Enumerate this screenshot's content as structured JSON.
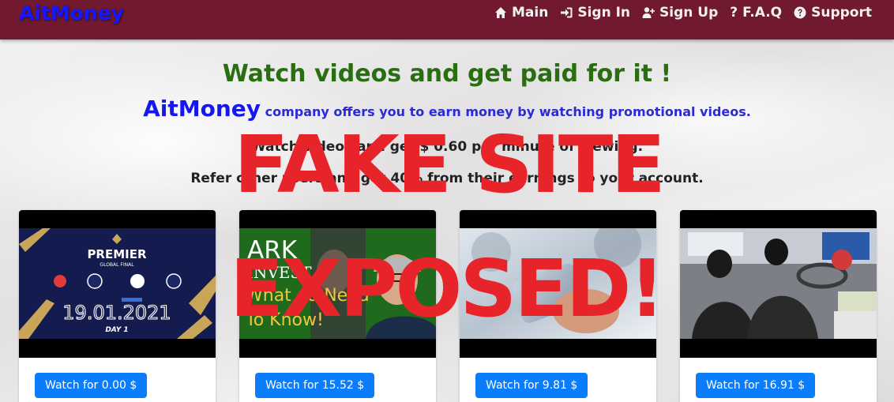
{
  "navbar": {
    "brand": "AitMoney",
    "items": [
      {
        "label": "Main",
        "icon": "home-icon"
      },
      {
        "label": "Sign In",
        "icon": "sign-in-icon"
      },
      {
        "label": "Sign Up",
        "icon": "user-plus-icon"
      },
      {
        "label": "F.A.Q",
        "icon": "question-icon"
      },
      {
        "label": "Support",
        "icon": "question-circle-icon"
      }
    ]
  },
  "hero": {
    "headline": "Watch videos and get paid for it !",
    "brand_word": "AitMoney",
    "offer_text": "company offers you to earn money",
    "offer_bold": "by watching promotional videos.",
    "rate_line": "Watch videos and get $ 0.60 per minute of viewing.",
    "referral_line": "Refer other users and get 40% from their earnings to your account."
  },
  "overlay": {
    "line1": "FAKE SITE",
    "line2": "EXPOSED!"
  },
  "cards": [
    {
      "thumb_title": "PREMIER",
      "thumb_subtitle": "GLOBAL FINAL",
      "thumb_date": "19.01.2021",
      "thumb_day": "DAY 1",
      "button": "Watch for 0.00 $"
    },
    {
      "thumb_title": "ARK",
      "thumb_subtitle": "INVEST",
      "thumb_caption1": "What ou Need",
      "thumb_caption2": "To Know!",
      "button": "Watch for 15.52 $"
    },
    {
      "button": "Watch for 9.81 $"
    },
    {
      "button": "Watch for 16.91 $"
    }
  ],
  "colors": {
    "navbar": "#71192e",
    "brand": "#1616ff",
    "headline": "#2a6e12",
    "button": "#0b7dfa",
    "overlay": "#e8242b"
  }
}
